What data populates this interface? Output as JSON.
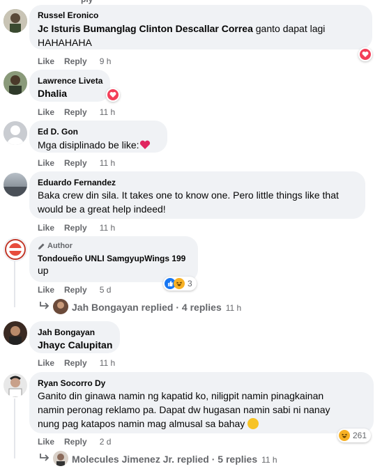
{
  "top_actions": {
    "reply_partial": "ply"
  },
  "comments": [
    {
      "name": "Russel Eronico",
      "tag": "Jc Isturis Bumanglag Clinton Descallar Correa",
      "text": " ganto dapat lagi",
      "text2": "HAHAHAHA",
      "like": "Like",
      "reply": "Reply",
      "time": "9 h"
    },
    {
      "name": "Lawrence Liveta",
      "text": "Dhalia",
      "like": "Like",
      "reply": "Reply",
      "time": "11 h"
    },
    {
      "name": "Ed D. Gon",
      "text": "Mga disiplinado be like:",
      "like": "Like",
      "reply": "Reply",
      "time": "11 h"
    },
    {
      "name": "Eduardo Fernandez",
      "line1": "Baka crew din sila. It takes one to know one. Pero little things like that",
      "line2": "would be a great help indeed!",
      "like": "Like",
      "reply": "Reply",
      "time": "11 h"
    },
    {
      "author_badge": "Author",
      "name": "Tondoueño UNLI SamgyupWings 199",
      "text": "up",
      "like": "Like",
      "reply": "Reply",
      "time": "5 d",
      "reaction_count": "3"
    },
    {
      "name": "Jah Bongayan",
      "text": "Jhayc Calupitan",
      "like": "Like",
      "reply": "Reply",
      "time": "11 h"
    },
    {
      "name": "Ryan Socorro Dy",
      "line1": "Ganito din ginawa namin ng kapatid ko, niligpit namin pinagkainan",
      "line2": "namin peronag reklamo pa. Dapat dw hugasan namin sabi ni nanay",
      "line3": "nung pag katapos namin mag almusal sa bahay",
      "like": "Like",
      "reply": "Reply",
      "time": "2 d",
      "reaction_count": "261"
    }
  ],
  "replied_rows": [
    {
      "text": "Jah Bongayan replied · 4 replies",
      "time": "11 h"
    },
    {
      "text": "Molecules Jimenez Jr. replied · 5 replies",
      "time": "11 h"
    }
  ],
  "colors": {
    "bubble": "#f0f2f5",
    "meta": "#65676b",
    "heart": "#f33e58",
    "like_blue": "#1877f2"
  }
}
